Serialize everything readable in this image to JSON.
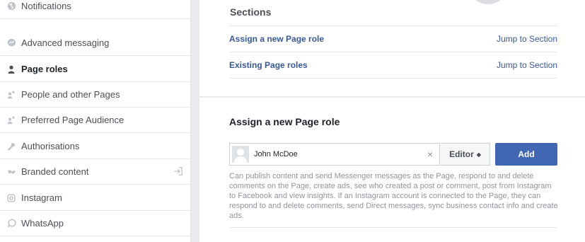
{
  "sidebar": {
    "items": [
      {
        "label": "Notifications",
        "icon": "globe-icon"
      },
      {
        "label": "Advanced messaging",
        "icon": "messenger-icon"
      },
      {
        "label": "Page roles",
        "icon": "person-icon",
        "active": true
      },
      {
        "label": "People and other Pages",
        "icon": "people-icon"
      },
      {
        "label": "Preferred Page Audience",
        "icon": "people-icon"
      },
      {
        "label": "Authorisations",
        "icon": "wrench-icon"
      },
      {
        "label": "Branded content",
        "icon": "handshake-icon",
        "extra_icon": "sign-in-icon"
      },
      {
        "label": "Instagram",
        "icon": "instagram-icon"
      },
      {
        "label": "WhatsApp",
        "icon": "whatsapp-icon"
      }
    ]
  },
  "sections": {
    "title": "Sections",
    "rows": [
      {
        "label": "Assign a new Page role",
        "jump": "Jump to Section"
      },
      {
        "label": "Existing Page roles",
        "jump": "Jump to Section"
      }
    ]
  },
  "assign": {
    "title": "Assign a new Page role",
    "input_value": "John McDoe",
    "clear_glyph": "×",
    "role": "Editor",
    "caret_glyph": "◆",
    "add_label": "Add",
    "description": "Can publish content and send Messenger messages as the Page, respond to and delete comments on the Page, create ads, see who created a post or comment, post from Instagram to Facebook and view insights. If an Instagram account is connected to the Page, they can respond to and delete comments, send Direct messages, sync business contact info and create ads."
  },
  "colors": {
    "link": "#365899",
    "primary_button": "#4267b2",
    "page_bg": "#e9ebee"
  }
}
